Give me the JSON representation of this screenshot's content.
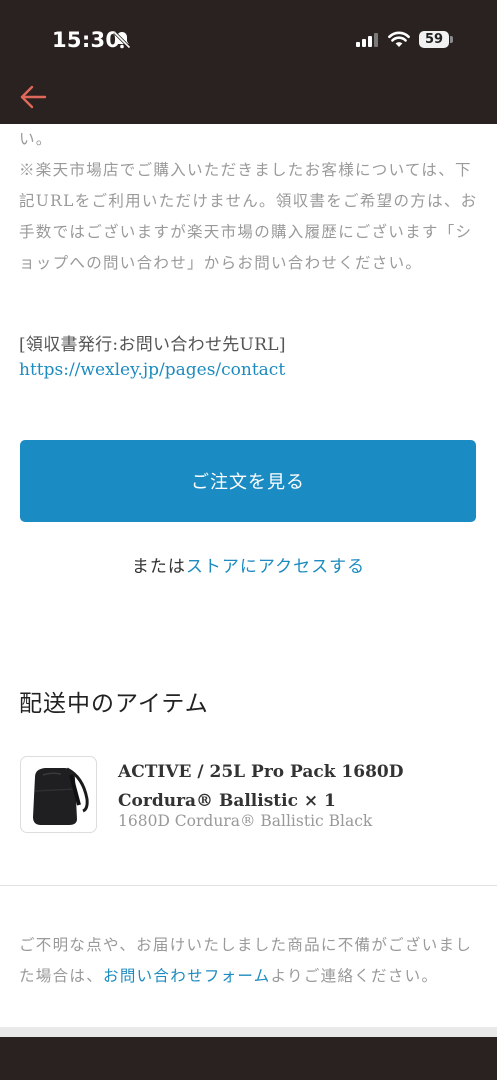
{
  "status_bar": {
    "time": "15:30",
    "battery": "59",
    "icons": [
      "bell-slash-icon",
      "signal-icon",
      "wifi-icon",
      "battery-icon"
    ]
  },
  "nav": {
    "back_icon": "arrow-left-icon",
    "accent_color": "#e0685a"
  },
  "notice": {
    "line1": "い。",
    "line2": "※楽天市場店でご購入いただきましたお客様については、下記URLをご利用いただけません。領収書をご希望の方は、お手数ではございますが楽天市場の購入履歴にございます「ショップへの問い合わせ」からお問い合わせください。"
  },
  "receipt": {
    "label": "[領収書発行:お問い合わせ先URL]",
    "url": "https://wexley.jp/pages/contact"
  },
  "actions": {
    "view_order": "ご注文を見る",
    "or_prefix": "または",
    "store_link": "ストアにアクセスする"
  },
  "shipping": {
    "title": "配送中のアイテム",
    "item": {
      "name": "ACTIVE / 25L Pro Pack 1680D Cordura® Ballistic × 1",
      "variant": "1680D Cordura® Ballistic Black"
    }
  },
  "footer": {
    "prefix": "ご不明な点や、お届けいたしました商品に不備がございました場合は、",
    "link": "お問い合わせフォーム",
    "suffix": "よりご連絡ください。"
  },
  "colors": {
    "header_bg": "#2a2220",
    "button_bg": "#1b8cc3",
    "link": "#1d8bbf",
    "muted_text": "#9a9a9a"
  }
}
